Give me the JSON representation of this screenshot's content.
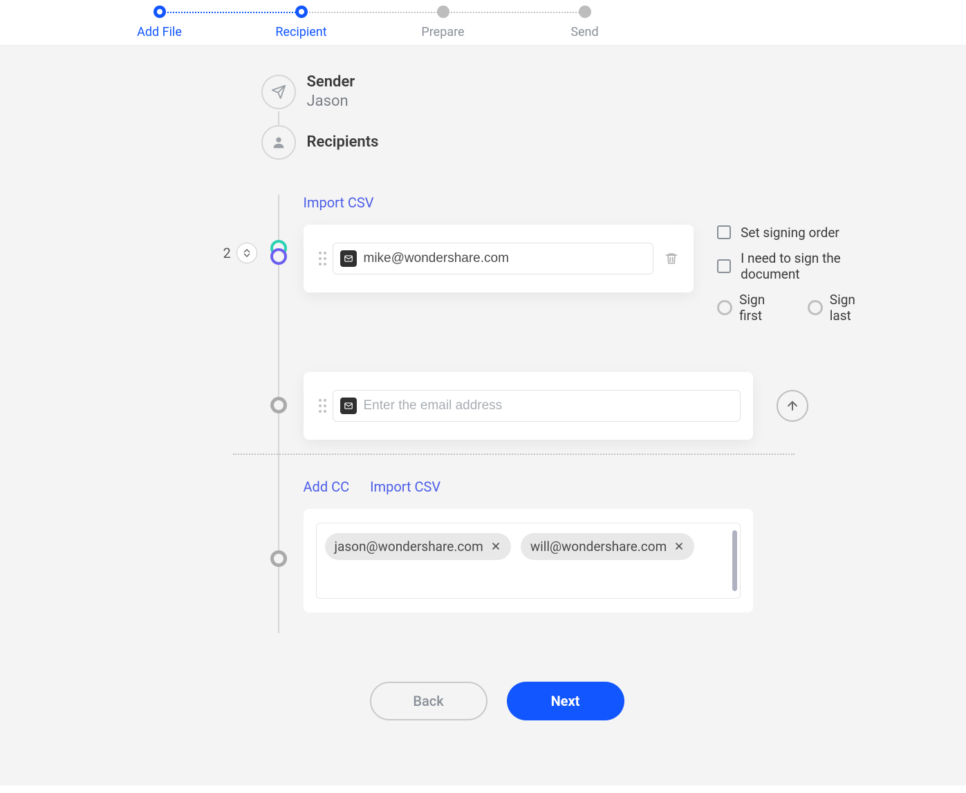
{
  "stepper": {
    "steps": [
      "Add File",
      "Recipient",
      "Prepare",
      "Send"
    ],
    "active_index": 1
  },
  "sender": {
    "label": "Sender",
    "name": "Jason"
  },
  "recipients": {
    "label": "Recipients",
    "import_csv": "Import CSV",
    "stack_count": "2",
    "items": [
      {
        "email": "mike@wondershare.com"
      }
    ],
    "empty_placeholder": "Enter the email address"
  },
  "options": {
    "set_order": "Set signing order",
    "need_sign": "I need to sign the document",
    "sign_first": "Sign first",
    "sign_last": "Sign last"
  },
  "cc": {
    "add_label": "Add CC",
    "import_csv": "Import CSV",
    "chips": [
      "jason@wondershare.com",
      "will@wondershare.com"
    ]
  },
  "buttons": {
    "back": "Back",
    "next": "Next"
  }
}
